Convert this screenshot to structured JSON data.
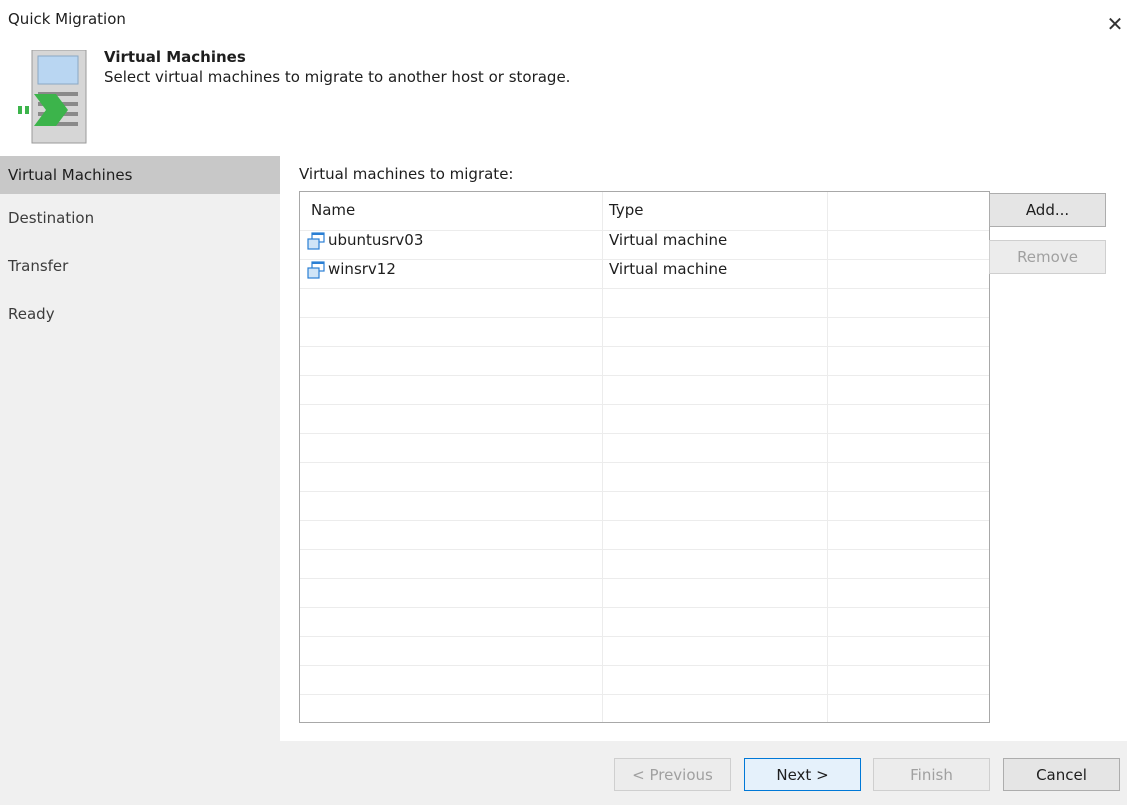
{
  "window": {
    "title": "Quick Migration",
    "close_icon": "close-icon"
  },
  "header": {
    "step_title": "Virtual Machines",
    "step_description": "Select virtual machines to migrate to another host or storage.",
    "icon": "migration-wizard-icon"
  },
  "sidebar": {
    "items": [
      {
        "label": "Virtual Machines",
        "active": true
      },
      {
        "label": "Destination",
        "active": false
      },
      {
        "label": "Transfer",
        "active": false
      },
      {
        "label": "Ready",
        "active": false
      }
    ]
  },
  "main": {
    "list_label": "Virtual machines to migrate:",
    "columns": [
      "Name",
      "Type",
      ""
    ],
    "rows": [
      {
        "name": "ubuntusrv03",
        "type": "Virtual machine",
        "icon": "vm-icon"
      },
      {
        "name": "winsrv12",
        "type": "Virtual machine",
        "icon": "vm-icon"
      }
    ],
    "add_label": "Add...",
    "remove_label": "Remove"
  },
  "footer": {
    "previous_label": "< Previous",
    "next_label": "Next >",
    "finish_label": "Finish",
    "cancel_label": "Cancel"
  },
  "colors": {
    "sidebar_bg": "#f0f0f0",
    "sidebar_active": "#c8c8c8",
    "accent_blue": "#0078d7",
    "icon_green": "#3cb44b"
  }
}
